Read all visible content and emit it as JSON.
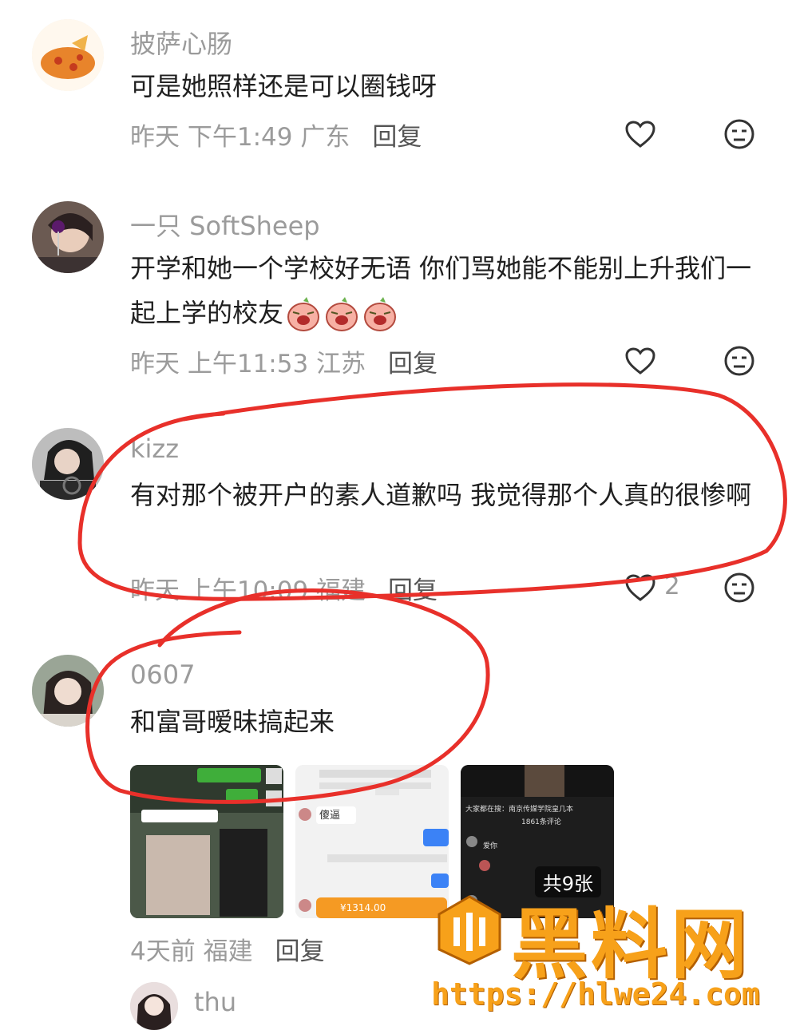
{
  "comments": [
    {
      "username": "披萨心肠",
      "text": "可是她照样还是可以圈钱呀",
      "meta": "昨天 下午1:49 广东",
      "reply": "回复",
      "likes": ""
    },
    {
      "username": "一只 SoftSheep",
      "text": "开学和她一个学校好无语 你们骂她能不能别上升我们一起上学的校友",
      "meta": "昨天 上午11:53 江苏",
      "reply": "回复",
      "likes": ""
    },
    {
      "username": "kizz",
      "text": "有对那个被开户的素人道歉吗 我觉得那个人真的很惨啊",
      "meta": "昨天 上午10:09 福建",
      "reply": "回复",
      "likes": "2"
    },
    {
      "username": "0607",
      "text": "和富哥暧昧搞起来",
      "meta": "4天前 福建",
      "reply": "回复",
      "images_badge": "共9张",
      "thumb2_text": "傻逼",
      "thumb2_amount": "¥1314.00",
      "thumb3_header": "大家都在搜：南京传媒学院皇几本",
      "thumb3_count": "1861条评论",
      "thumb3_line": "爱你"
    },
    {
      "username": "thu"
    }
  ],
  "watermark": {
    "title": "黑料网",
    "url": "https://hlwe24.com"
  },
  "colors": {
    "annotation_red": "#e8302a",
    "watermark_orange": "#f7a11a",
    "meta_gray": "#9b9b9b"
  }
}
